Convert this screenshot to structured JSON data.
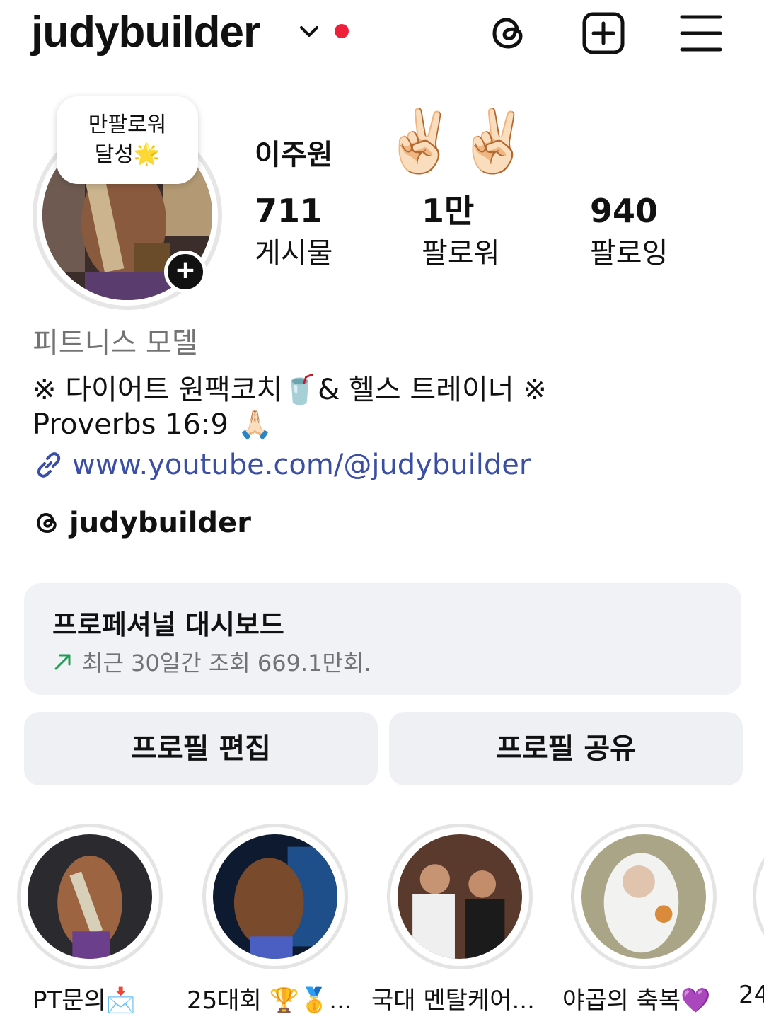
{
  "header": {
    "username": "judybuilder"
  },
  "profile": {
    "note_line1": "만팔로워",
    "note_line2": "달성🌟",
    "name": "이주원",
    "emojis": [
      "✌🏻",
      "✌🏻"
    ],
    "stats": [
      {
        "value": "711",
        "label": "게시물"
      },
      {
        "value": "1만",
        "label": "팔로워"
      },
      {
        "value": "940",
        "label": "팔로잉"
      }
    ]
  },
  "bio": {
    "category": "피트니스 모델",
    "line1": "※ 다이어트 원팩코치🥤& 헬스 트레이너 ※",
    "line2": "Proverbs 16:9 🙏🏻",
    "link": "www.youtube.com/@judybuilder",
    "threads_handle": "judybuilder"
  },
  "dashboard": {
    "title": "프로페셔널 대시보드",
    "subtitle": "최근 30일간 조회 669.1만회."
  },
  "buttons": {
    "edit": "프로필 편집",
    "share": "프로필 공유"
  },
  "highlights": [
    {
      "label": "PT문의📩"
    },
    {
      "label": "25대회 🏆🥇..."
    },
    {
      "label": "국대 멘탈케어..."
    },
    {
      "label": "야곱의 축복💜"
    },
    {
      "label": "24"
    }
  ],
  "colors": {
    "notification_dot": "#ef1f3a",
    "link": "#3b4ea6",
    "trend_up": "#1f9d55",
    "button_bg": "#eff0f3"
  }
}
